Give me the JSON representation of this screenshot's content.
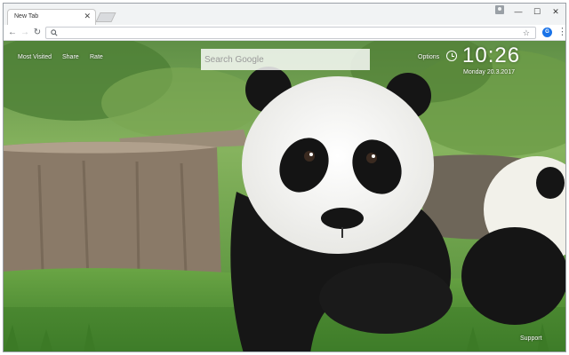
{
  "browser": {
    "tab_title": "New Tab",
    "tab_close_icon": "close-icon",
    "window_controls": [
      "minimize-icon",
      "maximize-icon",
      "close-icon"
    ],
    "omnibox": {
      "value": "",
      "placeholder": ""
    }
  },
  "ntp": {
    "links": {
      "most_visited": "Most Visited",
      "share": "Share",
      "rate": "Rate",
      "options": "Options",
      "support": "Support"
    },
    "search": {
      "placeholder": "Search Google"
    },
    "clock": {
      "time": "10:26",
      "date": "Monday  20.3.2017"
    }
  },
  "colors": {
    "browser_chrome": "#f1f3f4",
    "accent": "#1a73e8",
    "grass": "#4f8a3a",
    "panda_black": "#1a1a1a"
  }
}
